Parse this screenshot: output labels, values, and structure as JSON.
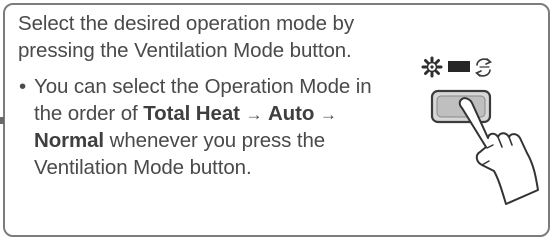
{
  "instruction": {
    "intro_line1": "Select the desired operation mode by",
    "intro_line2": "pressing the Ventilation Mode button.",
    "bullet_symbol": "•",
    "bullet_line1": "You can select the Operation Mode in",
    "bullet_line2_prefix": "the order of",
    "mode_total_heat": "Total Heat",
    "arrow": "→",
    "mode_auto": "Auto",
    "mode_normal": "Normal",
    "bullet_line3_suffix": "whenever you press the",
    "bullet_line4": "Ventilation Mode button."
  },
  "illustration": {
    "indicator_icons": [
      "fan-snowflake-icon",
      "bar-indicator-icon",
      "cycle-icon"
    ],
    "button": "ventilation-mode-button",
    "hand": "pointing-hand-icon"
  }
}
